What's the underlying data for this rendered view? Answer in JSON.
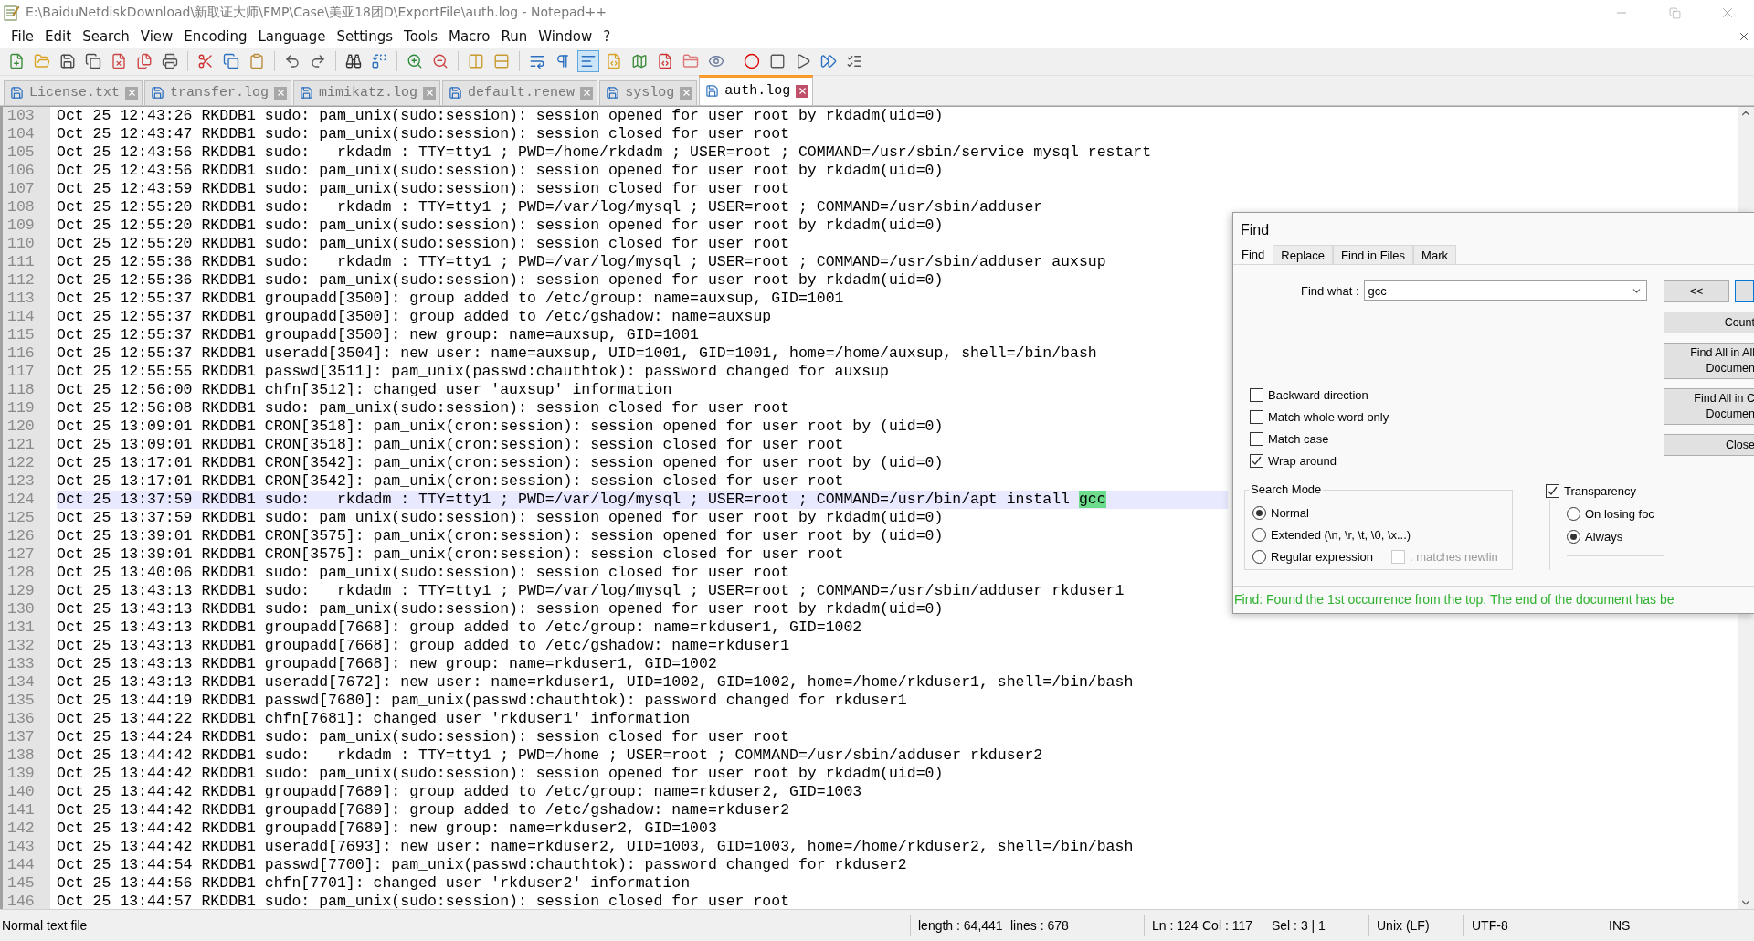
{
  "window": {
    "title": "E:\\BaiduNetdiskDownload\\新取证大师\\FMP\\Case\\美亚18团D\\ExportFile\\auth.log - Notepad++"
  },
  "menu": [
    "File",
    "Edit",
    "Search",
    "View",
    "Encoding",
    "Language",
    "Settings",
    "Tools",
    "Macro",
    "Run",
    "Window",
    "?"
  ],
  "tabs": [
    {
      "label": "License.txt",
      "selected": false
    },
    {
      "label": "transfer.log",
      "selected": false
    },
    {
      "label": "mimikatz.log",
      "selected": false
    },
    {
      "label": "default.renew",
      "selected": false
    },
    {
      "label": "syslog",
      "selected": false
    },
    {
      "label": "auth.log",
      "selected": true
    }
  ],
  "editor": {
    "lines": [
      {
        "number": "103",
        "text": "Oct 25 12:43:26 RKDDB1 sudo: pam_unix(sudo:session): session opened for user root by rkdadm(uid=0)",
        "current": false
      },
      {
        "number": "104",
        "text": "Oct 25 12:43:47 RKDDB1 sudo: pam_unix(sudo:session): session closed for user root",
        "current": false
      },
      {
        "number": "105",
        "text": "Oct 25 12:43:56 RKDDB1 sudo:   rkdadm : TTY=tty1 ; PWD=/home/rkdadm ; USER=root ; COMMAND=/usr/sbin/service mysql restart",
        "current": false
      },
      {
        "number": "106",
        "text": "Oct 25 12:43:56 RKDDB1 sudo: pam_unix(sudo:session): session opened for user root by rkdadm(uid=0)",
        "current": false
      },
      {
        "number": "107",
        "text": "Oct 25 12:43:59 RKDDB1 sudo: pam_unix(sudo:session): session closed for user root",
        "current": false
      },
      {
        "number": "108",
        "text": "Oct 25 12:55:20 RKDDB1 sudo:   rkdadm : TTY=tty1 ; PWD=/var/log/mysql ; USER=root ; COMMAND=/usr/sbin/adduser",
        "current": false
      },
      {
        "number": "109",
        "text": "Oct 25 12:55:20 RKDDB1 sudo: pam_unix(sudo:session): session opened for user root by rkdadm(uid=0)",
        "current": false
      },
      {
        "number": "110",
        "text": "Oct 25 12:55:20 RKDDB1 sudo: pam_unix(sudo:session): session closed for user root",
        "current": false
      },
      {
        "number": "111",
        "text": "Oct 25 12:55:36 RKDDB1 sudo:   rkdadm : TTY=tty1 ; PWD=/var/log/mysql ; USER=root ; COMMAND=/usr/sbin/adduser auxsup",
        "current": false
      },
      {
        "number": "112",
        "text": "Oct 25 12:55:36 RKDDB1 sudo: pam_unix(sudo:session): session opened for user root by rkdadm(uid=0)",
        "current": false
      },
      {
        "number": "113",
        "text": "Oct 25 12:55:37 RKDDB1 groupadd[3500]: group added to /etc/group: name=auxsup, GID=1001",
        "current": false
      },
      {
        "number": "114",
        "text": "Oct 25 12:55:37 RKDDB1 groupadd[3500]: group added to /etc/gshadow: name=auxsup",
        "current": false
      },
      {
        "number": "115",
        "text": "Oct 25 12:55:37 RKDDB1 groupadd[3500]: new group: name=auxsup, GID=1001",
        "current": false
      },
      {
        "number": "116",
        "text": "Oct 25 12:55:37 RKDDB1 useradd[3504]: new user: name=auxsup, UID=1001, GID=1001, home=/home/auxsup, shell=/bin/bash",
        "current": false
      },
      {
        "number": "117",
        "text": "Oct 25 12:55:55 RKDDB1 passwd[3511]: pam_unix(passwd:chauthtok): password changed for auxsup",
        "current": false
      },
      {
        "number": "118",
        "text": "Oct 25 12:56:00 RKDDB1 chfn[3512]: changed user 'auxsup' information",
        "current": false
      },
      {
        "number": "119",
        "text": "Oct 25 12:56:08 RKDDB1 sudo: pam_unix(sudo:session): session closed for user root",
        "current": false
      },
      {
        "number": "120",
        "text": "Oct 25 13:09:01 RKDDB1 CRON[3518]: pam_unix(cron:session): session opened for user root by (uid=0)",
        "current": false
      },
      {
        "number": "121",
        "text": "Oct 25 13:09:01 RKDDB1 CRON[3518]: pam_unix(cron:session): session closed for user root",
        "current": false
      },
      {
        "number": "122",
        "text": "Oct 25 13:17:01 RKDDB1 CRON[3542]: pam_unix(cron:session): session opened for user root by (uid=0)",
        "current": false
      },
      {
        "number": "123",
        "text": "Oct 25 13:17:01 RKDDB1 CRON[3542]: pam_unix(cron:session): session closed for user root",
        "current": false
      },
      {
        "number": "124",
        "text": "Oct 25 13:37:59 RKDDB1 sudo:   rkdadm : TTY=tty1 ; PWD=/var/log/mysql ; USER=root ; COMMAND=/usr/bin/apt install ",
        "match": "gcc",
        "current": true
      },
      {
        "number": "125",
        "text": "Oct 25 13:37:59 RKDDB1 sudo: pam_unix(sudo:session): session opened for user root by rkdadm(uid=0)",
        "current": false
      },
      {
        "number": "126",
        "text": "Oct 25 13:39:01 RKDDB1 CRON[3575]: pam_unix(cron:session): session opened for user root by (uid=0)",
        "current": false
      },
      {
        "number": "127",
        "text": "Oct 25 13:39:01 RKDDB1 CRON[3575]: pam_unix(cron:session): session closed for user root",
        "current": false
      },
      {
        "number": "128",
        "text": "Oct 25 13:40:06 RKDDB1 sudo: pam_unix(sudo:session): session closed for user root",
        "current": false
      },
      {
        "number": "129",
        "text": "Oct 25 13:43:13 RKDDB1 sudo:   rkdadm : TTY=tty1 ; PWD=/var/log/mysql ; USER=root ; COMMAND=/usr/sbin/adduser rkduser1",
        "current": false
      },
      {
        "number": "130",
        "text": "Oct 25 13:43:13 RKDDB1 sudo: pam_unix(sudo:session): session opened for user root by rkdadm(uid=0)",
        "current": false
      },
      {
        "number": "131",
        "text": "Oct 25 13:43:13 RKDDB1 groupadd[7668]: group added to /etc/group: name=rkduser1, GID=1002",
        "current": false
      },
      {
        "number": "132",
        "text": "Oct 25 13:43:13 RKDDB1 groupadd[7668]: group added to /etc/gshadow: name=rkduser1",
        "current": false
      },
      {
        "number": "133",
        "text": "Oct 25 13:43:13 RKDDB1 groupadd[7668]: new group: name=rkduser1, GID=1002",
        "current": false
      },
      {
        "number": "134",
        "text": "Oct 25 13:43:13 RKDDB1 useradd[7672]: new user: name=rkduser1, UID=1002, GID=1002, home=/home/rkduser1, shell=/bin/bash",
        "current": false
      },
      {
        "number": "135",
        "text": "Oct 25 13:44:19 RKDDB1 passwd[7680]: pam_unix(passwd:chauthtok): password changed for rkduser1",
        "current": false
      },
      {
        "number": "136",
        "text": "Oct 25 13:44:22 RKDDB1 chfn[7681]: changed user 'rkduser1' information",
        "current": false
      },
      {
        "number": "137",
        "text": "Oct 25 13:44:24 RKDDB1 sudo: pam_unix(sudo:session): session closed for user root",
        "current": false
      },
      {
        "number": "138",
        "text": "Oct 25 13:44:42 RKDDB1 sudo:   rkdadm : TTY=tty1 ; PWD=/home ; USER=root ; COMMAND=/usr/sbin/adduser rkduser2",
        "current": false
      },
      {
        "number": "139",
        "text": "Oct 25 13:44:42 RKDDB1 sudo: pam_unix(sudo:session): session opened for user root by rkdadm(uid=0)",
        "current": false
      },
      {
        "number": "140",
        "text": "Oct 25 13:44:42 RKDDB1 groupadd[7689]: group added to /etc/group: name=rkduser2, GID=1003",
        "current": false
      },
      {
        "number": "141",
        "text": "Oct 25 13:44:42 RKDDB1 groupadd[7689]: group added to /etc/gshadow: name=rkduser2",
        "current": false
      },
      {
        "number": "142",
        "text": "Oct 25 13:44:42 RKDDB1 groupadd[7689]: new group: name=rkduser2, GID=1003",
        "current": false
      },
      {
        "number": "143",
        "text": "Oct 25 13:44:42 RKDDB1 useradd[7693]: new user: name=rkduser2, UID=1003, GID=1003, home=/home/rkduser2, shell=/bin/bash",
        "current": false
      },
      {
        "number": "144",
        "text": "Oct 25 13:44:54 RKDDB1 passwd[7700]: pam_unix(passwd:chauthtok): password changed for rkduser2",
        "current": false
      },
      {
        "number": "145",
        "text": "Oct 25 13:44:56 RKDDB1 chfn[7701]: changed user 'rkduser2' information",
        "current": false
      },
      {
        "number": "146",
        "text": "Oct 25 13:44:57 RKDDB1 sudo: pam_unix(sudo:session): session closed for user root",
        "current": false
      }
    ]
  },
  "find_dialog": {
    "title": "Find",
    "tabs": [
      {
        "label": "Find",
        "selected": true
      },
      {
        "label": "Replace",
        "selected": false
      },
      {
        "label": "Find in Files",
        "selected": false
      },
      {
        "label": "Mark",
        "selected": false
      }
    ],
    "find_what": {
      "label": "Find what :",
      "value": "gcc"
    },
    "prev_button": "<<",
    "buttons": [
      {
        "lines": [
          "Count"
        ]
      },
      {
        "lines": [
          "Find All in All",
          "Documen"
        ]
      },
      {
        "lines": [
          "Find All in C",
          "Documen"
        ]
      },
      {
        "lines": [
          "Close"
        ]
      }
    ],
    "options": [
      {
        "label": "Backward direction",
        "checked": false
      },
      {
        "label": "Match whole word only",
        "checked": false
      },
      {
        "label": "Match case",
        "checked": false
      },
      {
        "label": "Wrap around",
        "checked": true
      }
    ],
    "search_mode": {
      "title": "Search Mode",
      "options": [
        {
          "label": "Normal",
          "selected": true
        },
        {
          "label": "Extended (\\n, \\r, \\t, \\0, \\x...)",
          "selected": false
        },
        {
          "label": "Regular expression",
          "selected": false
        }
      ],
      "dot_newline": {
        "label": ". matches newlin",
        "checked": false,
        "disabled": true
      }
    },
    "transparency": {
      "label": "Transparency",
      "checked": true,
      "options": [
        {
          "label": "On losing foc",
          "selected": false
        },
        {
          "label": "Always",
          "selected": true
        }
      ]
    },
    "message": "Find: Found the 1st occurrence from the top. The end of the document has be"
  },
  "status_bar": {
    "doc_type": "Normal text file",
    "length": "length : 64,441",
    "lines": "lines : 678",
    "ln": "Ln : 124",
    "col": "Col : 117",
    "sel": "Sel : 3 | 1",
    "eol": "Unix (LF)",
    "encoding": "UTF-8",
    "mode": "INS"
  }
}
